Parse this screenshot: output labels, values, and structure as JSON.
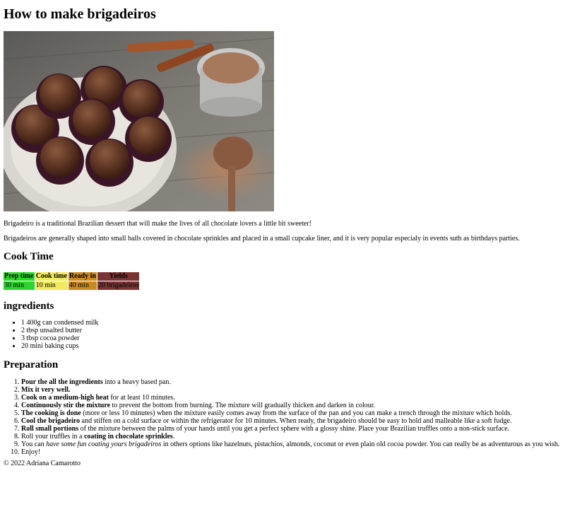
{
  "title": "How to make brigadeiros",
  "hero_image": {
    "description": "chocolate truffles in cupcake liners on a plate"
  },
  "intro": [
    "Brigadeiro is a traditional Brazilian dessert that will make the lives of all chocolate lovers a little bit sweeter!",
    "Brigadeiros are generally shaped into small balls covered in chocolate sprinkles and placed in a small cupcake liner, and it is very popular especialy in events suth as birthdays parties."
  ],
  "cook_time": {
    "heading": "Cook Time",
    "headers": [
      "Prep time",
      "Cook time",
      "Ready in",
      "Yields"
    ],
    "values": [
      "30 min",
      "10 min",
      "40 min",
      "20 brigadeiros"
    ],
    "colors": [
      "#2ad62a",
      "#f2ea5a",
      "#cc8a1c",
      "#7a3434"
    ]
  },
  "ingredients": {
    "heading": "ingredients",
    "items": [
      "1 400g can condensed milk",
      "2 tbsp unsalted butter",
      "3 tbsp cocoa powder",
      "20 mini baking cups"
    ]
  },
  "preparation": {
    "heading": "Preparation",
    "steps": [
      {
        "bold": "Pour the all the ingredients",
        "rest": " into a heavy based pan."
      },
      {
        "bold": "Mix it very well.",
        "rest": ""
      },
      {
        "bold": "Cook on a medium-high heat",
        "rest": " for at least 10 minutes."
      },
      {
        "bold": "Continuously stir the mixture",
        "rest": " to prevent the bottom from burning. The mixture will gradually thicken and darken in colour."
      },
      {
        "bold": "The cooking is done",
        "rest": " (more or less 10 minutes) when the mixture easily comes away from the surface of the pan and you can make a trench through the mixture which holds."
      },
      {
        "bold": "Cool the brigadeiro",
        "rest": " and stiffen on a cold surface or within the refrigerator for 10 minutes. When ready, the brigadeiro should be easy to hold and malleable like a soft fudge."
      },
      {
        "bold": "Roll small portions",
        "rest": " of the mixture between the palms of your hands until you get a perfect sphere with a glossy shine. Place your Brazilian truffles onto a non-stick surface."
      },
      {
        "pre": "Roll your truffles in a ",
        "bold": "coating in chocolate sprinkles",
        "rest": "."
      },
      {
        "pre": "You can ",
        "italic": "have some fun coating yours brigadeiros",
        "rest": " in others options like hazelnuts, pistachios, almonds, coconut or even plain old cocoa powder. You can really be as adventurous as you wish."
      },
      {
        "rest": "Enjoy!"
      }
    ]
  },
  "footer": "© 2022 Adriana Camarotto"
}
